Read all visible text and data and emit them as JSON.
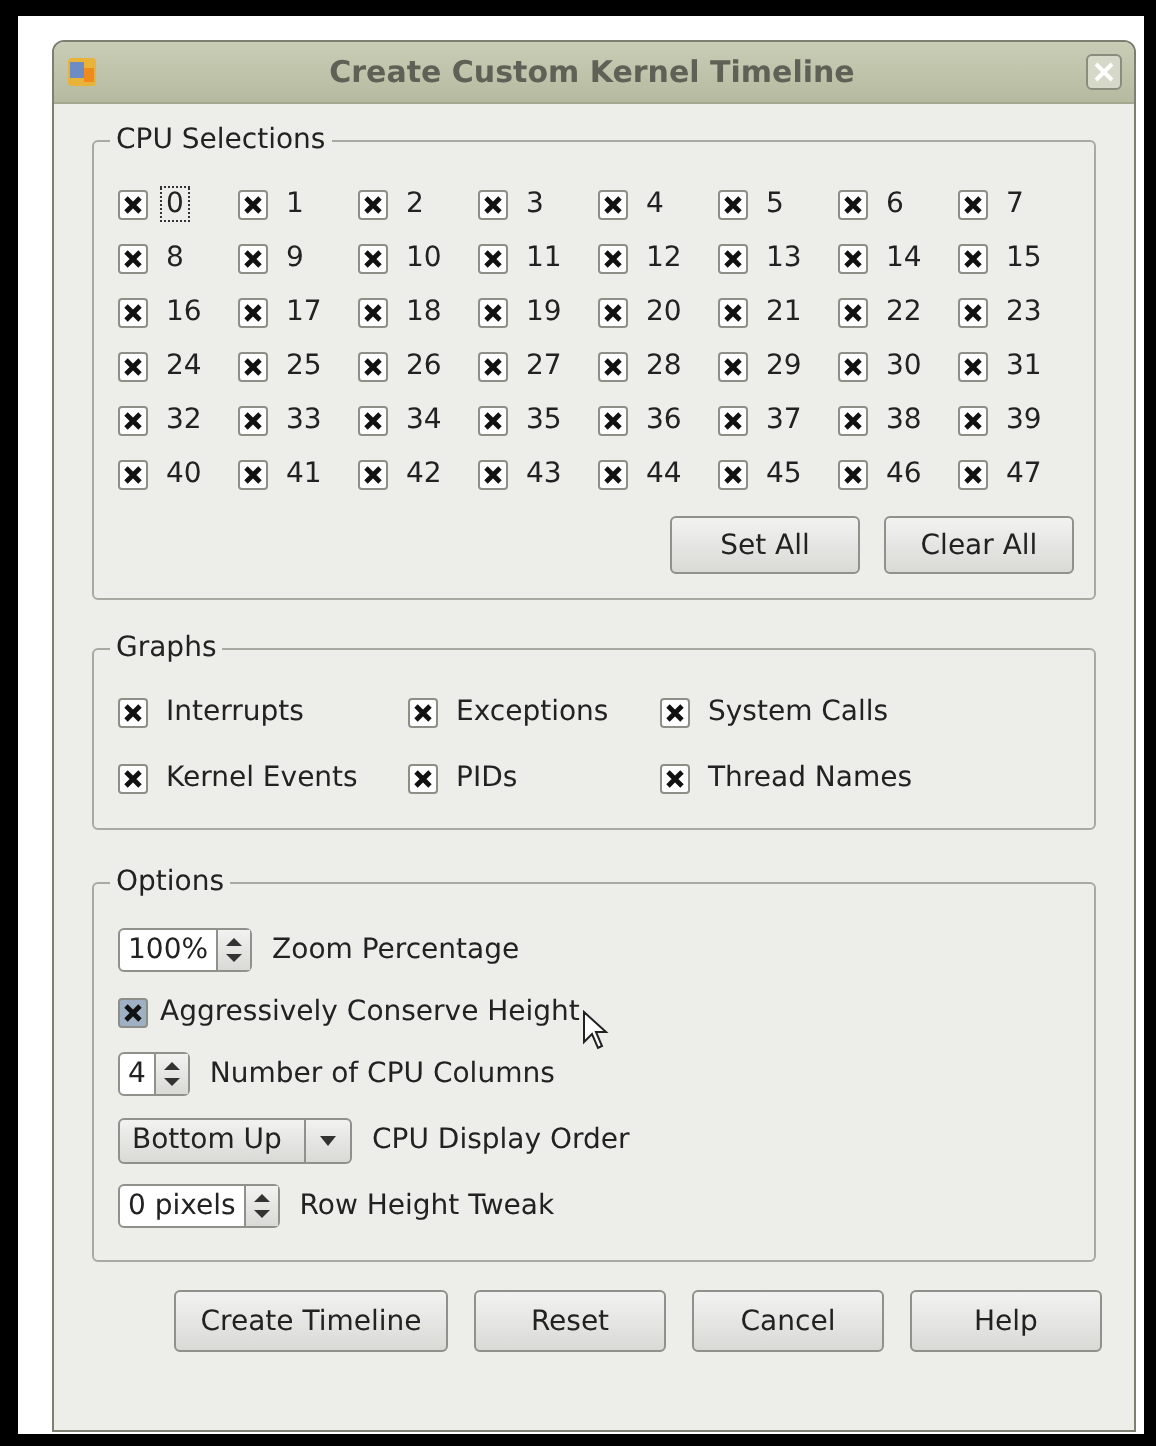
{
  "window": {
    "title": "Create Custom Kernel Timeline"
  },
  "cpu_selections": {
    "title": "CPU Selections",
    "cpus": [
      {
        "label": "0",
        "checked": true,
        "focused": true
      },
      {
        "label": "1",
        "checked": true,
        "focused": false
      },
      {
        "label": "2",
        "checked": true,
        "focused": false
      },
      {
        "label": "3",
        "checked": true,
        "focused": false
      },
      {
        "label": "4",
        "checked": true,
        "focused": false
      },
      {
        "label": "5",
        "checked": true,
        "focused": false
      },
      {
        "label": "6",
        "checked": true,
        "focused": false
      },
      {
        "label": "7",
        "checked": true,
        "focused": false
      },
      {
        "label": "8",
        "checked": true,
        "focused": false
      },
      {
        "label": "9",
        "checked": true,
        "focused": false
      },
      {
        "label": "10",
        "checked": true,
        "focused": false
      },
      {
        "label": "11",
        "checked": true,
        "focused": false
      },
      {
        "label": "12",
        "checked": true,
        "focused": false
      },
      {
        "label": "13",
        "checked": true,
        "focused": false
      },
      {
        "label": "14",
        "checked": true,
        "focused": false
      },
      {
        "label": "15",
        "checked": true,
        "focused": false
      },
      {
        "label": "16",
        "checked": true,
        "focused": false
      },
      {
        "label": "17",
        "checked": true,
        "focused": false
      },
      {
        "label": "18",
        "checked": true,
        "focused": false
      },
      {
        "label": "19",
        "checked": true,
        "focused": false
      },
      {
        "label": "20",
        "checked": true,
        "focused": false
      },
      {
        "label": "21",
        "checked": true,
        "focused": false
      },
      {
        "label": "22",
        "checked": true,
        "focused": false
      },
      {
        "label": "23",
        "checked": true,
        "focused": false
      },
      {
        "label": "24",
        "checked": true,
        "focused": false
      },
      {
        "label": "25",
        "checked": true,
        "focused": false
      },
      {
        "label": "26",
        "checked": true,
        "focused": false
      },
      {
        "label": "27",
        "checked": true,
        "focused": false
      },
      {
        "label": "28",
        "checked": true,
        "focused": false
      },
      {
        "label": "29",
        "checked": true,
        "focused": false
      },
      {
        "label": "30",
        "checked": true,
        "focused": false
      },
      {
        "label": "31",
        "checked": true,
        "focused": false
      },
      {
        "label": "32",
        "checked": true,
        "focused": false
      },
      {
        "label": "33",
        "checked": true,
        "focused": false
      },
      {
        "label": "34",
        "checked": true,
        "focused": false
      },
      {
        "label": "35",
        "checked": true,
        "focused": false
      },
      {
        "label": "36",
        "checked": true,
        "focused": false
      },
      {
        "label": "37",
        "checked": true,
        "focused": false
      },
      {
        "label": "38",
        "checked": true,
        "focused": false
      },
      {
        "label": "39",
        "checked": true,
        "focused": false
      },
      {
        "label": "40",
        "checked": true,
        "focused": false
      },
      {
        "label": "41",
        "checked": true,
        "focused": false
      },
      {
        "label": "42",
        "checked": true,
        "focused": false
      },
      {
        "label": "43",
        "checked": true,
        "focused": false
      },
      {
        "label": "44",
        "checked": true,
        "focused": false
      },
      {
        "label": "45",
        "checked": true,
        "focused": false
      },
      {
        "label": "46",
        "checked": true,
        "focused": false
      },
      {
        "label": "47",
        "checked": true,
        "focused": false
      }
    ],
    "buttons": [
      "Set All",
      "Clear All"
    ]
  },
  "graphs": {
    "title": "Graphs",
    "items": [
      {
        "label": "Interrupts",
        "checked": true
      },
      {
        "label": "Exceptions",
        "checked": true
      },
      {
        "label": "System Calls",
        "checked": true
      },
      {
        "label": "Kernel Events",
        "checked": true
      },
      {
        "label": "PIDs",
        "checked": true
      },
      {
        "label": "Thread Names",
        "checked": true
      }
    ]
  },
  "options": {
    "title": "Options",
    "rows": [
      {
        "kind": "spinbox",
        "value": "100%",
        "label": "Zoom Percentage"
      },
      {
        "kind": "checkbox",
        "checked": true,
        "hovered": true,
        "label": "Aggressively Conserve Height"
      },
      {
        "kind": "spinbox",
        "value": "4",
        "label": "Number of CPU Columns"
      },
      {
        "kind": "combo",
        "selected_option": "Bottom Up",
        "label": "CPU Display Order"
      },
      {
        "kind": "spinbox",
        "value": "0 pixels",
        "label": "Row Height Tweak"
      }
    ]
  },
  "buttons": [
    "Create Timeline",
    "Reset",
    "Cancel",
    "Help"
  ]
}
